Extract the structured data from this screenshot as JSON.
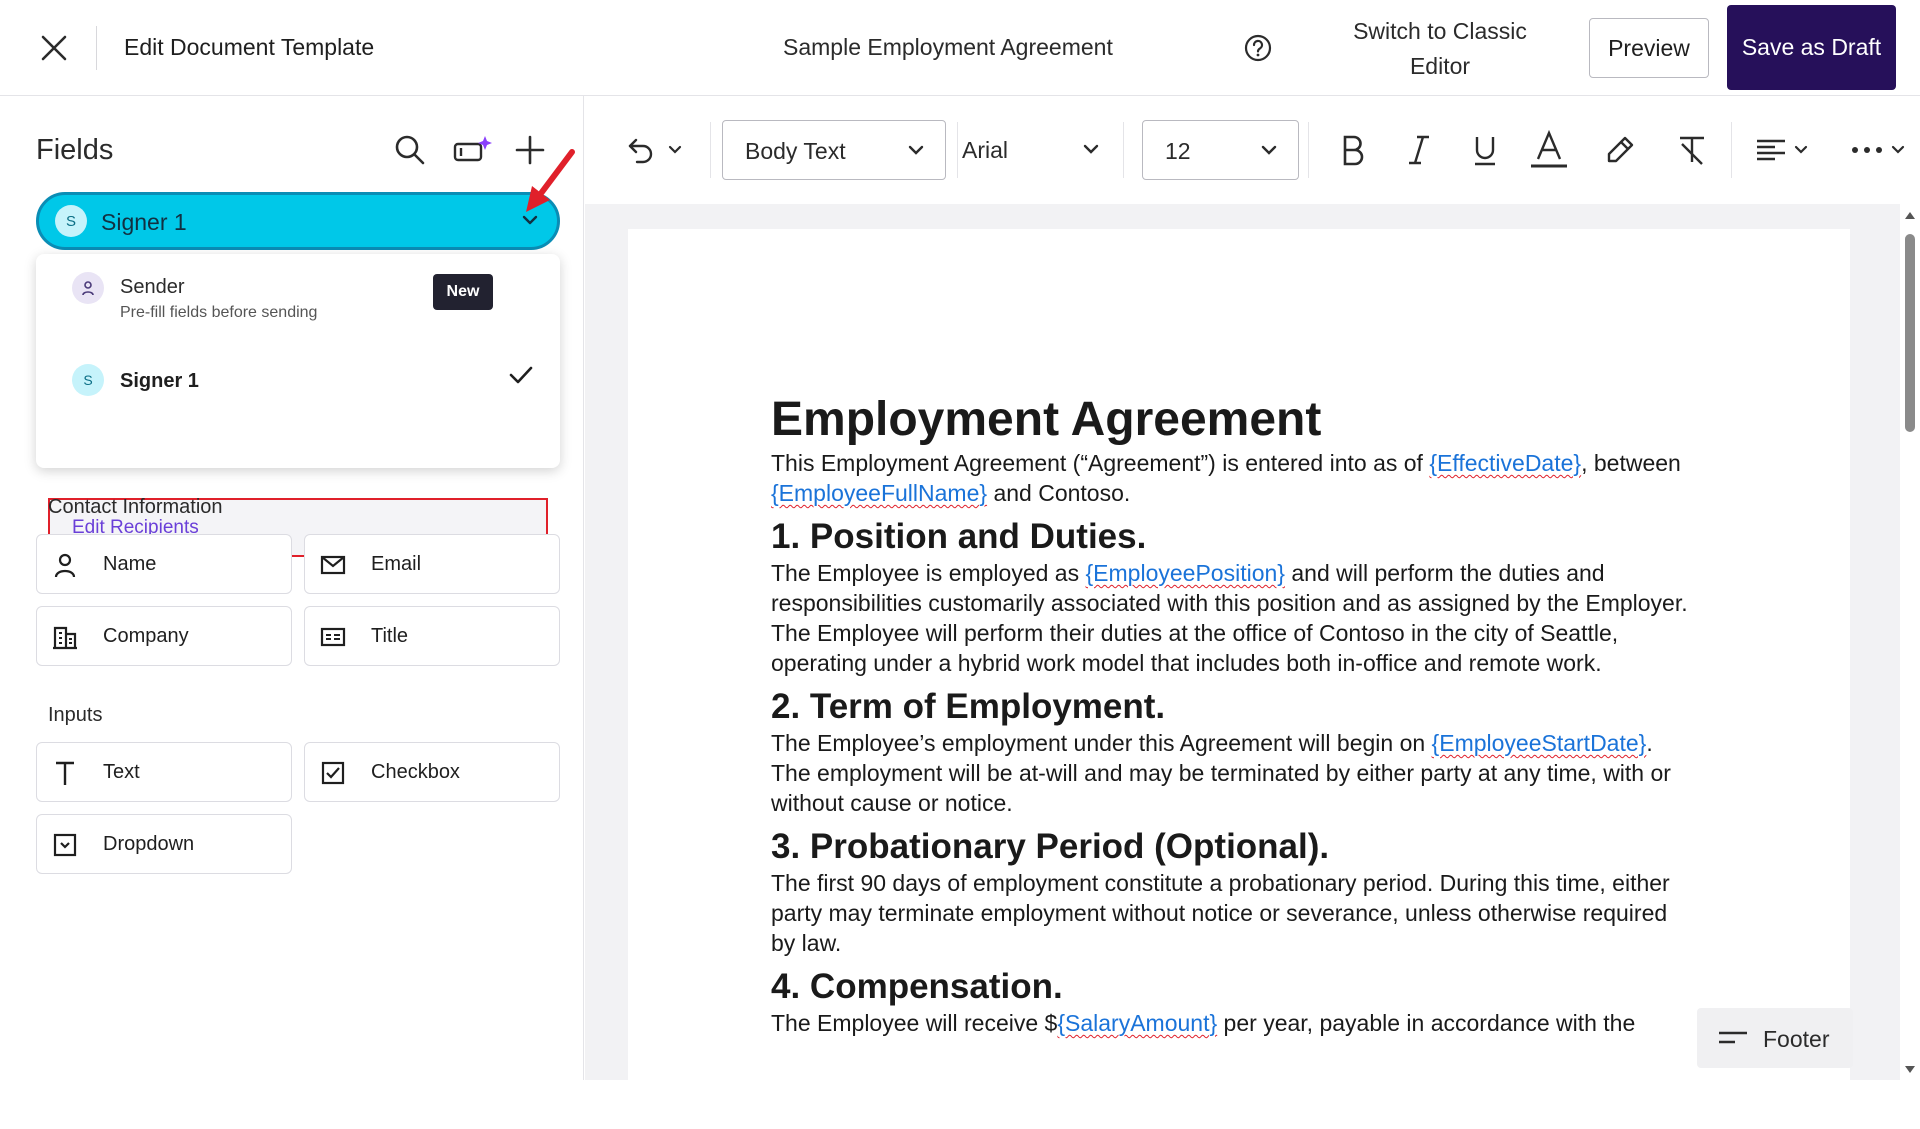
{
  "header": {
    "title": "Edit Document Template",
    "document_name": "Sample Employment Agreement",
    "switch_classic_label": "Switch to Classic Editor",
    "preview_label": "Preview",
    "save_draft_label": "Save as Draft"
  },
  "sidebar": {
    "title": "Fields",
    "selected_recipient": {
      "initial": "S",
      "label": "Signer 1"
    },
    "recipient_menu": {
      "sender": {
        "initial": "",
        "title": "Sender",
        "subtitle": "Pre-fill fields before sending",
        "badge": "New"
      },
      "signer": {
        "initial": "S",
        "label": "Signer 1",
        "selected": true
      },
      "edit_recipients_label": "Edit Recipients"
    },
    "contact_section": {
      "label": "Contact Information",
      "items": [
        {
          "label": "Name",
          "icon": "person-icon"
        },
        {
          "label": "Email",
          "icon": "envelope-icon"
        },
        {
          "label": "Company",
          "icon": "building-icon"
        },
        {
          "label": "Title",
          "icon": "id-card-icon"
        }
      ]
    },
    "inputs_section": {
      "label": "Inputs",
      "items": [
        {
          "label": "Text",
          "icon": "text-t-icon"
        },
        {
          "label": "Checkbox",
          "icon": "checkbox-icon"
        },
        {
          "label": "Dropdown",
          "icon": "dropdown-box-icon"
        }
      ]
    }
  },
  "toolbar": {
    "style": "Body Text",
    "font": "Arial",
    "font_size": "12"
  },
  "document": {
    "title": "Employment Agreement",
    "intro_pre": "This Employment Agreement (“Agreement”) is entered into as of ",
    "intro_ph1": "{EffectiveDate}",
    "intro_mid": ", between ",
    "intro_ph2": "{EmployeeFullName}",
    "intro_post": " and Contoso.",
    "s1_heading": "1. Position and Duties.",
    "s1_pre": "The Employee is employed as ",
    "s1_ph": "{EmployeePosition}",
    "s1_post": " and will perform the duties and responsibilities customarily associated with this position and as assigned by the Employer. The Employee will perform their duties at the office of Contoso in the city of Seattle, operating under a hybrid work model that includes both in-office and remote work.",
    "s2_heading": "2. Term of Employment.",
    "s2_pre": "The Employee’s employment under this Agreement will begin on ",
    "s2_ph": "{EmployeeStartDate}",
    "s2_post": ". The employment will be at-will and may be terminated by either party at any time, with or without cause or notice.",
    "s3_heading": "3. Probationary Period (Optional).",
    "s3_text": "The first 90 days of employment constitute a probationary period. During this time, either party may terminate employment without notice or severance, unless otherwise required by law.",
    "s4_heading": "4. Compensation.",
    "s4_pre": "The Employee will receive $",
    "s4_ph": "{SalaryAmount}",
    "s4_post": " per year, payable in accordance with the"
  },
  "footer_button_label": "Footer",
  "colors": {
    "accent_dark": "#26105a",
    "signer_cyan": "#00c8e8",
    "link_purple": "#6a3fd8",
    "placeholder_blue": "#1a73d9",
    "annotation_red": "#e0202a"
  }
}
